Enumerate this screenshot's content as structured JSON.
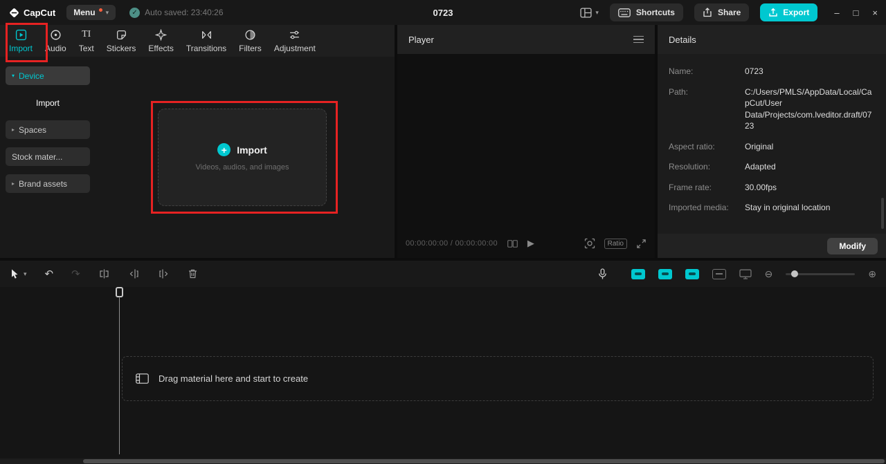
{
  "colors": {
    "accent": "#00c8d0",
    "annotation": "#e62222"
  },
  "titlebar": {
    "logo_text": "CapCut",
    "menu_label": "Menu",
    "autosave_text": "Auto saved: 23:40:26",
    "project_title": "0723",
    "shortcuts_label": "Shortcuts",
    "share_label": "Share",
    "export_label": "Export"
  },
  "icons": {
    "check": "✓",
    "caret_down": "▾",
    "caret_right": "▸",
    "minimize": "–",
    "maximize": "□",
    "close": "×",
    "play": "▶",
    "undo": "↶",
    "redo": "↷",
    "plus": "+",
    "zoom_out": "⊖",
    "zoom_in": "⊕",
    "text_tab": "TI"
  },
  "media_tabs": [
    {
      "label": "Import"
    },
    {
      "label": "Audio"
    },
    {
      "label": "Text"
    },
    {
      "label": "Stickers"
    },
    {
      "label": "Effects"
    },
    {
      "label": "Transitions"
    },
    {
      "label": "Filters"
    },
    {
      "label": "Adjustment"
    }
  ],
  "sidebar": {
    "device": "Device",
    "import_sub": "Import",
    "spaces": "Spaces",
    "stock": "Stock mater...",
    "brand": "Brand assets"
  },
  "import_zone": {
    "title": "Import",
    "subtitle": "Videos, audios, and images"
  },
  "player": {
    "title": "Player",
    "timecode": "00:00:00:00 / 00:00:00:00",
    "ratio_label": "Ratio"
  },
  "details": {
    "title": "Details",
    "fields": [
      {
        "label": "Name:",
        "value": "0723"
      },
      {
        "label": "Path:",
        "value": "C:/Users/PMLS/AppData/Local/CapCut/User Data/Projects/com.lveditor.draft/0723"
      },
      {
        "label": "Aspect ratio:",
        "value": "Original"
      },
      {
        "label": "Resolution:",
        "value": "Adapted"
      },
      {
        "label": "Frame rate:",
        "value": "30.00fps"
      },
      {
        "label": "Imported media:",
        "value": "Stay in original location"
      }
    ],
    "modify_label": "Modify"
  },
  "timeline": {
    "drop_hint": "Drag material here and start to create"
  }
}
